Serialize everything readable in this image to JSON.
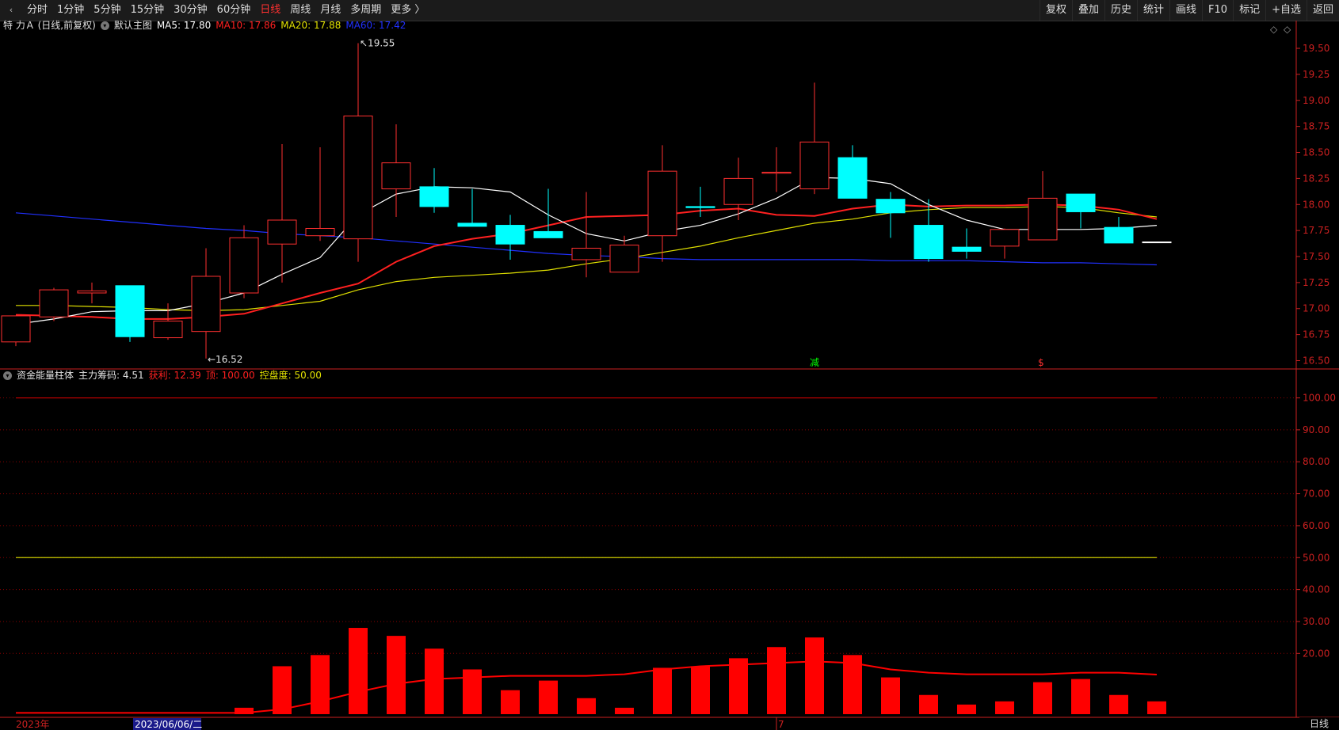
{
  "toolbar": {
    "left_items": [
      {
        "label": "分时",
        "active": false
      },
      {
        "label": "1分钟",
        "active": false
      },
      {
        "label": "5分钟",
        "active": false
      },
      {
        "label": "15分钟",
        "active": false
      },
      {
        "label": "30分钟",
        "active": false
      },
      {
        "label": "60分钟",
        "active": false
      },
      {
        "label": "日线",
        "active": true
      },
      {
        "label": "周线",
        "active": false
      },
      {
        "label": "月线",
        "active": false
      },
      {
        "label": "多周期",
        "active": false
      },
      {
        "label": "更多 〉",
        "active": false
      }
    ],
    "right_items": [
      "复权",
      "叠加",
      "历史",
      "统计",
      "画线",
      "F10",
      "标记",
      "+自选",
      "返回"
    ]
  },
  "main_info": {
    "stock": "特 力Ａ (日线,前复权)",
    "template": "默认主图",
    "ma5": "MA5: 17.80",
    "ma10": "MA10: 17.86",
    "ma20": "MA20: 17.88",
    "ma60": "MA60: 17.42"
  },
  "sub_info": {
    "name": "资金能量柱体",
    "chip": "主力筹码: 4.51",
    "profit": "获利: 12.39",
    "top": "顶: 100.00",
    "control": "控盘度: 50.00"
  },
  "colors": {
    "up": "#ff3030",
    "down": "#00ffff",
    "ma5": "#ffffff",
    "ma10": "#ff2020",
    "ma20": "#e0e000",
    "ma60": "#2030ff",
    "grid": "#8b0000",
    "axis": "#cc2020"
  },
  "chart_data": [
    {
      "type": "candlestick",
      "title": "",
      "price_axis_ticks": [
        16.5,
        16.75,
        17.0,
        17.25,
        17.5,
        17.75,
        18.0,
        18.25,
        18.5,
        18.75,
        19.0,
        19.25,
        19.5
      ],
      "ylim": [
        16.42,
        19.66
      ],
      "annotations": {
        "high": "19.55",
        "low": "16.52"
      },
      "marks": [
        {
          "bar": 21,
          "text": "减",
          "color": "#00ff00"
        },
        {
          "bar": 27,
          "text": "$",
          "color": "#ff3030"
        }
      ],
      "candles": [
        {
          "o": 16.68,
          "h": 16.78,
          "l": 16.64,
          "c": 16.93
        },
        {
          "o": 16.92,
          "h": 17.2,
          "l": 16.88,
          "c": 17.18
        },
        {
          "o": 17.15,
          "h": 17.25,
          "l": 17.05,
          "c": 17.17
        },
        {
          "o": 17.22,
          "h": 17.22,
          "l": 16.68,
          "c": 16.73
        },
        {
          "o": 16.72,
          "h": 17.05,
          "l": 16.7,
          "c": 16.88
        },
        {
          "o": 16.78,
          "h": 17.58,
          "l": 16.52,
          "c": 17.31
        },
        {
          "o": 17.15,
          "h": 17.8,
          "l": 17.1,
          "c": 17.68
        },
        {
          "o": 17.62,
          "h": 18.58,
          "l": 17.25,
          "c": 17.85
        },
        {
          "o": 17.7,
          "h": 18.55,
          "l": 17.65,
          "c": 17.77
        },
        {
          "o": 17.67,
          "h": 19.55,
          "l": 17.45,
          "c": 18.85
        },
        {
          "o": 18.15,
          "h": 18.77,
          "l": 17.88,
          "c": 18.4
        },
        {
          "o": 18.17,
          "h": 18.35,
          "l": 17.92,
          "c": 17.98
        },
        {
          "o": 17.82,
          "h": 18.15,
          "l": 17.8,
          "c": 17.79
        },
        {
          "o": 17.8,
          "h": 17.9,
          "l": 17.47,
          "c": 17.62
        },
        {
          "o": 17.74,
          "h": 18.15,
          "l": 17.68,
          "c": 17.68
        },
        {
          "o": 17.47,
          "h": 18.12,
          "l": 17.3,
          "c": 17.58
        },
        {
          "o": 17.35,
          "h": 17.7,
          "l": 17.35,
          "c": 17.61
        },
        {
          "o": 17.7,
          "h": 18.57,
          "l": 17.45,
          "c": 18.32
        },
        {
          "o": 17.98,
          "h": 18.17,
          "l": 17.88,
          "c": 17.97
        },
        {
          "o": 18.0,
          "h": 18.45,
          "l": 17.85,
          "c": 18.25
        },
        {
          "o": 18.3,
          "h": 18.55,
          "l": 18.12,
          "c": 18.31
        },
        {
          "o": 18.15,
          "h": 19.17,
          "l": 18.1,
          "c": 18.6
        },
        {
          "o": 18.45,
          "h": 18.57,
          "l": 18.06,
          "c": 18.06
        },
        {
          "o": 18.05,
          "h": 18.12,
          "l": 17.68,
          "c": 17.92
        },
        {
          "o": 17.8,
          "h": 18.05,
          "l": 17.45,
          "c": 17.48
        },
        {
          "o": 17.59,
          "h": 17.77,
          "l": 17.48,
          "c": 17.55
        },
        {
          "o": 17.6,
          "h": 17.77,
          "l": 17.48,
          "c": 17.76
        },
        {
          "o": 17.66,
          "h": 18.32,
          "l": 17.66,
          "c": 18.06
        },
        {
          "o": 18.1,
          "h": 18.1,
          "l": 17.77,
          "c": 17.93
        },
        {
          "o": 17.78,
          "h": 17.88,
          "l": 17.63,
          "c": 17.63
        },
        {
          "o": 17.64,
          "h": 17.64,
          "l": 17.64,
          "c": 17.64
        }
      ],
      "ma5": [
        16.85,
        16.9,
        16.97,
        16.98,
        16.98,
        17.05,
        17.15,
        17.33,
        17.49,
        17.9,
        18.1,
        18.17,
        18.16,
        18.12,
        17.9,
        17.72,
        17.65,
        17.74,
        17.8,
        17.91,
        18.06,
        18.26,
        18.25,
        18.2,
        18.0,
        17.85,
        17.76,
        17.76,
        17.76,
        17.77,
        17.8
      ],
      "ma10": [
        16.94,
        16.93,
        16.92,
        16.9,
        16.9,
        16.92,
        16.95,
        17.05,
        17.15,
        17.24,
        17.45,
        17.6,
        17.67,
        17.72,
        17.8,
        17.88,
        17.89,
        17.9,
        17.94,
        17.96,
        17.9,
        17.89,
        17.96,
        18.0,
        17.98,
        17.99,
        17.99,
        18.0,
        17.99,
        17.95,
        17.86
      ],
      "ma20": [
        17.03,
        17.03,
        17.02,
        17.01,
        16.99,
        16.98,
        16.99,
        17.03,
        17.07,
        17.18,
        17.26,
        17.3,
        17.32,
        17.34,
        17.37,
        17.43,
        17.48,
        17.54,
        17.6,
        17.68,
        17.75,
        17.82,
        17.86,
        17.92,
        17.95,
        17.97,
        17.97,
        17.98,
        17.97,
        17.92,
        17.88
      ],
      "ma60": [
        17.92,
        17.89,
        17.86,
        17.83,
        17.8,
        17.77,
        17.75,
        17.72,
        17.7,
        17.68,
        17.65,
        17.62,
        17.59,
        17.56,
        17.53,
        17.51,
        17.5,
        17.48,
        17.47,
        17.47,
        17.47,
        17.47,
        17.47,
        17.46,
        17.46,
        17.46,
        17.45,
        17.44,
        17.44,
        17.43,
        17.42
      ]
    },
    {
      "type": "bar",
      "title": "",
      "yticks": [
        20,
        30,
        40,
        50,
        60,
        70,
        80,
        90,
        100
      ],
      "ylim": [
        0,
        104.1
      ],
      "top_line": 100,
      "control_line": 50,
      "values": [
        0,
        0,
        0,
        0,
        0,
        0,
        3,
        16,
        19.5,
        28,
        25.5,
        21.5,
        15,
        8.5,
        11.5,
        6,
        3,
        15.5,
        16,
        18.5,
        22,
        25,
        19.5,
        12.5,
        7,
        4,
        5,
        11,
        12,
        7,
        5
      ],
      "profit_line": [
        0.4,
        0.4,
        0.4,
        0.4,
        0.4,
        0.4,
        0.4,
        1.5,
        4,
        7,
        9.5,
        11,
        11.5,
        12,
        12,
        12,
        12.5,
        14,
        15,
        15.5,
        16,
        16.5,
        16,
        14,
        13,
        12.5,
        12.5,
        12.5,
        13,
        13,
        12.39
      ]
    }
  ],
  "date_axis": {
    "year": "2023年",
    "cursor_date": "2023/06/06/二",
    "month": "7"
  },
  "period": "日线"
}
